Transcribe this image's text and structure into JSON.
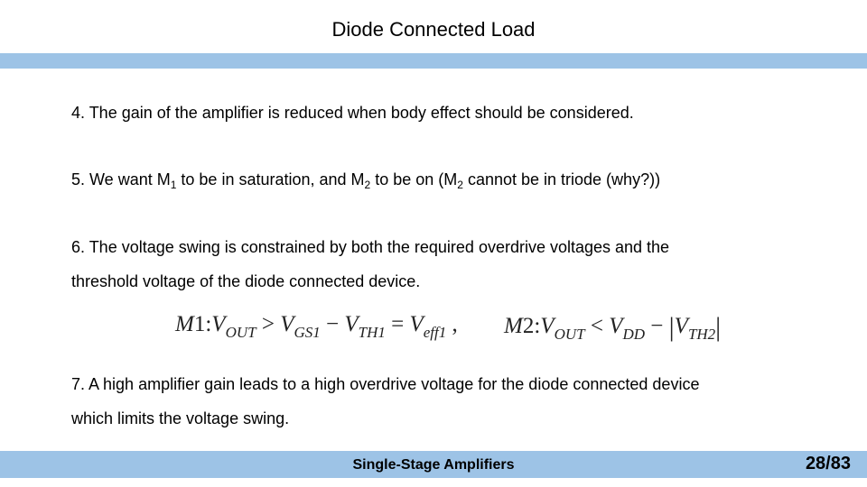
{
  "slide": {
    "title": "Diode Connected Load",
    "points": {
      "p4": "4. The gain of the amplifier is reduced when body effect should be considered.",
      "p5": {
        "a": "5. We want M",
        "s1": "1",
        "b": " to be in saturation, and M",
        "s2": "2",
        "c": " to be on (M",
        "s3": "2",
        "d": " cannot be in triode (why?))"
      },
      "p6_line1": "6. The voltage swing is constrained by both the required overdrive voltages and the",
      "p6_line2": "threshold voltage of the diode connected device.",
      "p7_line1": "7. A high amplifier gain leads to a high overdrive voltage for the diode connected device",
      "p7_line2": "which limits the voltage swing."
    },
    "equations": {
      "eq1": {
        "m": "M",
        "mn": "1",
        "colon": ":",
        "v1": "V",
        "s1": "OUT",
        "op1": " > ",
        "v2": "V",
        "s2": "GS1",
        "op2": " − ",
        "v3": "V",
        "s3": "TH1",
        "op3": " = ",
        "v4": "V",
        "s4": "eff1",
        "sep": " ,"
      },
      "eq2": {
        "m": "M",
        "mn": "2",
        "colon": ":",
        "v1": "V",
        "s1": "OUT",
        "op1": " < ",
        "v2": "V",
        "s2": "DD",
        "op2": " − ",
        "bar": "|",
        "v3": "V",
        "s3": "TH2"
      }
    },
    "footer": {
      "label": "Single-Stage Amplifiers",
      "page": "28/83"
    }
  }
}
